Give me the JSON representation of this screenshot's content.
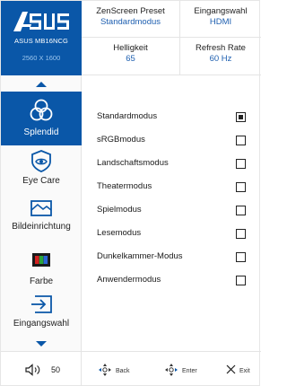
{
  "brand": {
    "logo_text": "/ISUS",
    "model": "ASUS MB16NCG",
    "resolution": "2560 X 1600",
    "color": "#0a57a8"
  },
  "status": {
    "preset_label": "ZenScreen Preset",
    "preset_value": "Standardmodus",
    "input_label": "Eingangswahl",
    "input_value": "HDMI",
    "brightness_label": "Helligkeit",
    "brightness_value": "65",
    "refresh_label": "Refresh Rate",
    "refresh_value": "60 Hz"
  },
  "sidebar": {
    "items": [
      {
        "label": "Splendid",
        "icon": "splendid-icon",
        "active": true
      },
      {
        "label": "Eye Care",
        "icon": "eye-care-icon",
        "active": false
      },
      {
        "label": "Bildeinrichtung",
        "icon": "image-icon",
        "active": false
      },
      {
        "label": "Farbe",
        "icon": "color-icon",
        "active": false
      },
      {
        "label": "Eingangswahl",
        "icon": "input-select-icon",
        "active": false
      }
    ]
  },
  "options": [
    {
      "label": "Standardmodus",
      "checked": true
    },
    {
      "label": "sRGBmodus",
      "checked": false
    },
    {
      "label": "Landschaftsmodus",
      "checked": false
    },
    {
      "label": "Theatermodus",
      "checked": false
    },
    {
      "label": "Spielmodus",
      "checked": false
    },
    {
      "label": "Lesemodus",
      "checked": false
    },
    {
      "label": "Dunkelkammer-Modus",
      "checked": false
    },
    {
      "label": "Anwendermodus",
      "checked": false
    }
  ],
  "footer": {
    "volume_value": "50",
    "back_label": "Back",
    "enter_label": "Enter",
    "exit_label": "Exit"
  }
}
